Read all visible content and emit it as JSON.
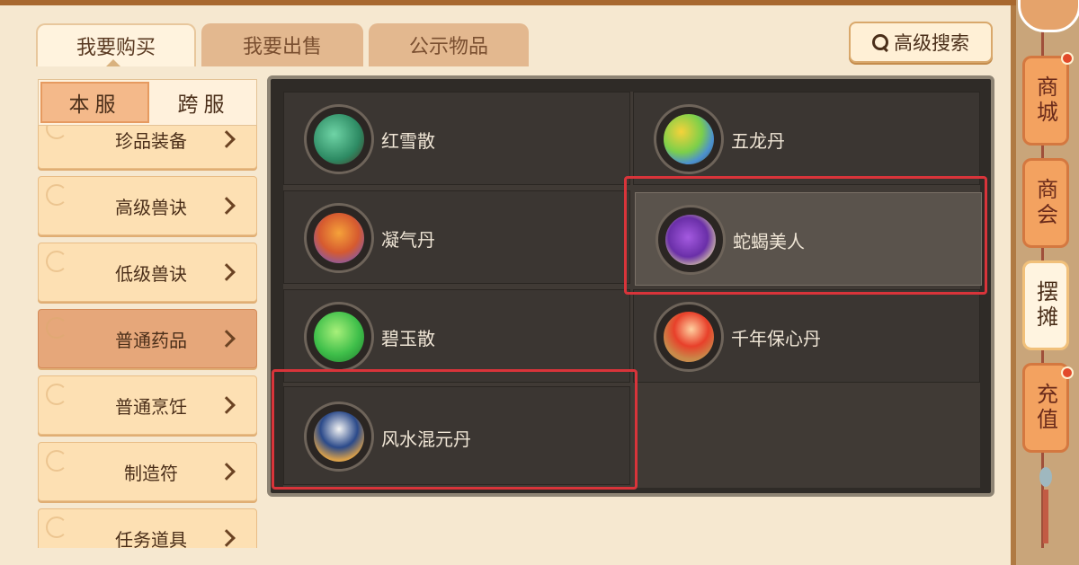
{
  "tabs": [
    {
      "label": "我要购买",
      "active": true
    },
    {
      "label": "我要出售",
      "active": false
    },
    {
      "label": "公示物品",
      "active": false
    }
  ],
  "advanced_search": {
    "label": "高级搜索",
    "icon": "search-icon"
  },
  "server_toggle": {
    "local": "本服",
    "cross": "跨服",
    "selected": "local"
  },
  "categories": [
    {
      "label": "珍品装备",
      "selected": false
    },
    {
      "label": "高级兽诀",
      "selected": false
    },
    {
      "label": "低级兽诀",
      "selected": false
    },
    {
      "label": "普通药品",
      "selected": true
    },
    {
      "label": "普通烹饪",
      "selected": false
    },
    {
      "label": "制造符",
      "selected": false
    },
    {
      "label": "任务道具",
      "selected": false
    }
  ],
  "items": [
    {
      "name": "红雪散",
      "icon": "red-snow-powder-icon",
      "highlighted": false
    },
    {
      "name": "五龙丹",
      "icon": "five-dragon-pill-icon",
      "highlighted": false
    },
    {
      "name": "凝气丹",
      "icon": "condensed-qi-pill-icon",
      "highlighted": false
    },
    {
      "name": "蛇蝎美人",
      "icon": "snake-scorpion-beauty-icon",
      "highlighted": true
    },
    {
      "name": "碧玉散",
      "icon": "jade-powder-icon",
      "highlighted": false
    },
    {
      "name": "千年保心丹",
      "icon": "millennium-heart-pill-icon",
      "highlighted": false
    },
    {
      "name": "风水混元丹",
      "icon": "fengshui-hunyuan-pill-icon",
      "highlighted": false
    }
  ],
  "side_tabs": [
    {
      "label": "商城",
      "selected": false,
      "notification": true
    },
    {
      "label": "商会",
      "selected": false,
      "notification": false
    },
    {
      "label": "摆摊",
      "selected": true,
      "notification": false
    },
    {
      "label": "充值",
      "selected": false,
      "notification": true
    }
  ],
  "colors": {
    "highlight_box": "#d9343a",
    "panel_bg": "#f6e8d0",
    "grid_bg": "#2f2b27"
  }
}
